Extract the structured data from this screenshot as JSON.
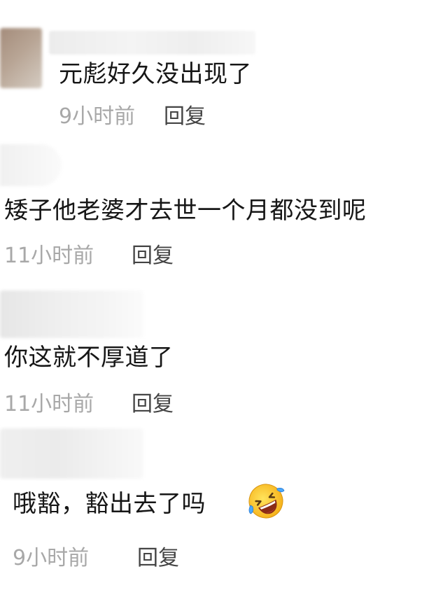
{
  "comments": [
    {
      "text": "元彪好久没出现了",
      "time": "9小时前",
      "reply_label": "回复"
    },
    {
      "text": "矮子他老婆才去世一个月都没到呢",
      "time": "11小时前",
      "reply_label": "回复"
    },
    {
      "text": "你这就不厚道了",
      "time": "11小时前",
      "reply_label": "回复"
    },
    {
      "text": "哦豁，豁出去了吗",
      "time": "9小时前",
      "reply_label": "回复",
      "emoji": "rolling-on-floor-laughing-emoji"
    }
  ],
  "colors": {
    "text": "#161616",
    "time": "#a8a8a8",
    "reply": "#444444",
    "background": "#ffffff"
  }
}
